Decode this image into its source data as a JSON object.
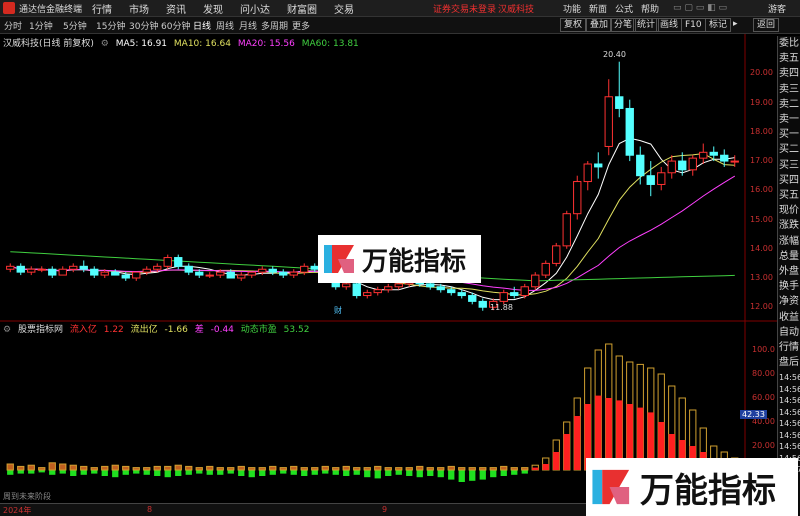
{
  "menubar": {
    "app_title": "通达信金融终端",
    "menus": [
      "行情",
      "市场",
      "资讯",
      "发现",
      "问小达",
      "财富圈",
      "交易"
    ],
    "warning": "证券交易未登录",
    "stock_name": "汉威科技",
    "right_menus": [
      "功能",
      "新面",
      "公式",
      "帮助"
    ],
    "guest": "游客"
  },
  "toolbar": {
    "periods": [
      "分时",
      "1分钟",
      "5分钟",
      "15分钟",
      "30分钟",
      "60分钟",
      "日线",
      "周线",
      "月线",
      "多周期",
      "更多"
    ],
    "right_buttons": [
      "复权",
      "叠加",
      "分笔",
      "统计",
      "画线",
      "F10",
      "标记",
      "返回"
    ],
    "collapse": "▸"
  },
  "price_header": {
    "title": "汉威科技(日线 前复权)",
    "ma5": "MA5: 16.91",
    "ma10": "MA10: 16.64",
    "ma20": "MA20: 15.56",
    "ma60": "MA60: 13.81"
  },
  "side_panel": [
    "委比",
    "卖五",
    "卖四",
    "卖三",
    "卖二",
    "卖一",
    "买一",
    "买二",
    "买三",
    "买四",
    "买五",
    "现价",
    "涨跌",
    "涨幅",
    "总量",
    "外盘",
    "换手",
    "净资",
    "收益",
    "自动",
    "行情",
    "盘后",
    "14:56",
    "14:56",
    "14:56",
    "14:56",
    "14:56",
    "14:56",
    "14:56",
    "14:56",
    "14:57"
  ],
  "price_axis": [
    "20.00",
    "19.00",
    "18.00",
    "17.00",
    "16.00",
    "15.00",
    "14.00",
    "13.00",
    "12.00"
  ],
  "annotations": {
    "high": "20.40",
    "low": "11.88",
    "cai": "财"
  },
  "sub_header": {
    "indicator": "股票指标网",
    "inflow_label": "流入亿",
    "inflow": "1.22",
    "outflow_label": "流出亿",
    "outflow": "-1.66",
    "diff_label": "差",
    "diff": "-0.44",
    "pe_label": "动态市盈",
    "pe": "53.52"
  },
  "vol_axis": [
    "100.0",
    "80.00",
    "60.00",
    "40.00",
    "20.00"
  ],
  "vol_marker": "42.33",
  "bottom_axis": [
    "2024年",
    "8",
    "9"
  ],
  "bottom_note": "周到未来阶段",
  "watermark": "万能指标",
  "colors": {
    "up": "#ff3232",
    "down": "#54ffff",
    "ma5": "#ffffff",
    "ma10": "#e0e060",
    "ma20": "#ff40ff",
    "ma60": "#40d040",
    "bar_red": "#ff2020",
    "bar_gold": "#d0a030",
    "bar_green": "#20e020",
    "axis_text": "#c83030"
  },
  "chart_data": {
    "type": "candlestick",
    "candles": [
      [
        13.3,
        13.5,
        13.2,
        13.4
      ],
      [
        13.4,
        13.5,
        13.1,
        13.2
      ],
      [
        13.2,
        13.4,
        13.1,
        13.3
      ],
      [
        13.3,
        13.4,
        13.2,
        13.3
      ],
      [
        13.3,
        13.4,
        13.0,
        13.1
      ],
      [
        13.1,
        13.4,
        13.1,
        13.3
      ],
      [
        13.3,
        13.5,
        13.2,
        13.4
      ],
      [
        13.4,
        13.6,
        13.2,
        13.3
      ],
      [
        13.3,
        13.4,
        13.0,
        13.1
      ],
      [
        13.1,
        13.3,
        13.0,
        13.2
      ],
      [
        13.2,
        13.3,
        13.1,
        13.1
      ],
      [
        13.1,
        13.2,
        12.9,
        13.0
      ],
      [
        13.0,
        13.2,
        12.9,
        13.2
      ],
      [
        13.2,
        13.4,
        13.1,
        13.3
      ],
      [
        13.3,
        13.5,
        13.2,
        13.4
      ],
      [
        13.4,
        13.8,
        13.3,
        13.7
      ],
      [
        13.7,
        13.8,
        13.3,
        13.4
      ],
      [
        13.4,
        13.5,
        13.1,
        13.2
      ],
      [
        13.2,
        13.3,
        13.0,
        13.1
      ],
      [
        13.1,
        13.2,
        13.0,
        13.1
      ],
      [
        13.1,
        13.3,
        13.0,
        13.2
      ],
      [
        13.2,
        13.3,
        13.0,
        13.0
      ],
      [
        13.0,
        13.2,
        12.9,
        13.1
      ],
      [
        13.1,
        13.2,
        13.0,
        13.2
      ],
      [
        13.2,
        13.4,
        13.1,
        13.3
      ],
      [
        13.3,
        13.4,
        13.1,
        13.2
      ],
      [
        13.2,
        13.3,
        13.0,
        13.1
      ],
      [
        13.1,
        13.3,
        13.0,
        13.2
      ],
      [
        13.2,
        13.5,
        13.1,
        13.4
      ],
      [
        13.4,
        13.5,
        13.2,
        13.3
      ],
      [
        13.3,
        13.4,
        13.1,
        13.1
      ],
      [
        13.1,
        13.2,
        12.6,
        12.7
      ],
      [
        12.7,
        12.9,
        12.6,
        12.8
      ],
      [
        12.8,
        12.9,
        12.3,
        12.4
      ],
      [
        12.4,
        12.6,
        12.3,
        12.5
      ],
      [
        12.5,
        12.7,
        12.4,
        12.6
      ],
      [
        12.6,
        12.8,
        12.5,
        12.7
      ],
      [
        12.7,
        12.9,
        12.6,
        12.8
      ],
      [
        12.8,
        13.0,
        12.7,
        12.9
      ],
      [
        12.9,
        13.0,
        12.7,
        12.8
      ],
      [
        12.8,
        12.9,
        12.6,
        12.7
      ],
      [
        12.7,
        12.8,
        12.5,
        12.6
      ],
      [
        12.6,
        12.7,
        12.4,
        12.5
      ],
      [
        12.5,
        12.6,
        12.3,
        12.4
      ],
      [
        12.4,
        12.5,
        12.1,
        12.2
      ],
      [
        12.2,
        12.3,
        11.88,
        12.0
      ],
      [
        12.0,
        12.3,
        11.9,
        12.2
      ],
      [
        12.2,
        12.6,
        12.1,
        12.5
      ],
      [
        12.5,
        12.7,
        12.3,
        12.4
      ],
      [
        12.4,
        12.8,
        12.3,
        12.7
      ],
      [
        12.7,
        13.2,
        12.6,
        13.1
      ],
      [
        13.1,
        13.6,
        13.0,
        13.5
      ],
      [
        13.5,
        14.2,
        13.4,
        14.1
      ],
      [
        14.1,
        15.3,
        14.0,
        15.2
      ],
      [
        15.2,
        16.5,
        15.0,
        16.3
      ],
      [
        16.3,
        17.0,
        16.0,
        16.9
      ],
      [
        16.9,
        17.3,
        16.4,
        16.8
      ],
      [
        17.5,
        19.8,
        17.2,
        19.2
      ],
      [
        19.2,
        20.4,
        18.5,
        18.8
      ],
      [
        18.8,
        19.1,
        17.0,
        17.2
      ],
      [
        17.2,
        17.5,
        16.2,
        16.5
      ],
      [
        16.5,
        17.0,
        15.8,
        16.2
      ],
      [
        16.2,
        16.8,
        16.0,
        16.6
      ],
      [
        16.6,
        17.2,
        16.4,
        17.0
      ],
      [
        17.0,
        17.3,
        16.5,
        16.7
      ],
      [
        16.7,
        17.2,
        16.5,
        17.1
      ],
      [
        17.1,
        17.6,
        16.9,
        17.3
      ],
      [
        17.3,
        17.5,
        17.0,
        17.2
      ],
      [
        17.2,
        17.4,
        16.8,
        17.0
      ],
      [
        17.0,
        17.2,
        16.8,
        17.0
      ]
    ],
    "y_range": [
      11.7,
      20.8
    ]
  },
  "vol_data": {
    "type": "bar",
    "gold": [
      5,
      3,
      4,
      2,
      6,
      5,
      4,
      3,
      2,
      3,
      4,
      3,
      2,
      2,
      3,
      3,
      4,
      3,
      2,
      3,
      2,
      2,
      3,
      2,
      2,
      3,
      2,
      3,
      2,
      2,
      3,
      2,
      3,
      2,
      2,
      3,
      2,
      2,
      2,
      3,
      2,
      2,
      3,
      2,
      2,
      2,
      2,
      3,
      2,
      2,
      4,
      10,
      25,
      40,
      60,
      85,
      100,
      105,
      95,
      90,
      88,
      85,
      80,
      70,
      60,
      50,
      35,
      20,
      15,
      10
    ],
    "red": [
      0,
      0,
      0,
      0,
      0,
      0,
      0,
      0,
      0,
      0,
      0,
      0,
      0,
      0,
      0,
      0,
      0,
      0,
      0,
      0,
      0,
      0,
      0,
      0,
      0,
      0,
      0,
      0,
      0,
      0,
      0,
      0,
      0,
      0,
      0,
      0,
      0,
      0,
      0,
      0,
      0,
      0,
      0,
      0,
      0,
      0,
      0,
      0,
      0,
      0,
      2,
      5,
      15,
      30,
      45,
      55,
      62,
      60,
      58,
      55,
      52,
      48,
      40,
      30,
      25,
      20,
      15,
      10,
      8,
      5
    ],
    "green": [
      4,
      3,
      3,
      2,
      4,
      3,
      5,
      4,
      3,
      5,
      6,
      4,
      3,
      4,
      5,
      6,
      5,
      4,
      3,
      4,
      4,
      3,
      5,
      6,
      5,
      4,
      3,
      4,
      5,
      4,
      3,
      4,
      5,
      4,
      6,
      7,
      5,
      4,
      5,
      6,
      5,
      6,
      8,
      10,
      9,
      8,
      6,
      5,
      4,
      3,
      0,
      0,
      0,
      0,
      0,
      0,
      0,
      0,
      0,
      0,
      0,
      0,
      0,
      0,
      0,
      0,
      0,
      0,
      0,
      0
    ],
    "y_range": [
      -25,
      110
    ]
  }
}
